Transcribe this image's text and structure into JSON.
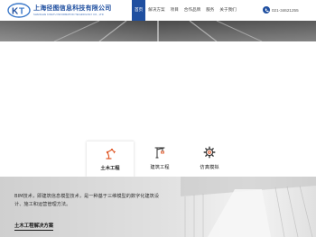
{
  "header": {
    "brand_cn": "上海径图信息科技有限公司",
    "brand_en": "SHANGHAI KINGTU INFORMATION TECHNOLOGY CO., LTD",
    "phone": "021-34621255"
  },
  "nav": {
    "items": [
      {
        "label": "首页",
        "active": true
      },
      {
        "label": "解决方案"
      },
      {
        "label": "项目"
      },
      {
        "label": "合作品牌"
      },
      {
        "label": "服务"
      },
      {
        "label": "关于我们"
      }
    ]
  },
  "services": [
    {
      "label": "土木工程",
      "icon": "robot-arm-icon",
      "active": true
    },
    {
      "label": "建筑工程",
      "icon": "crane-icon"
    },
    {
      "label": "仿真模拟",
      "icon": "gear-icon"
    }
  ],
  "bottom": {
    "description": "BIM技术，即建筑信息模型技术，是一种基于三维模型的数字化建筑设计、施工和运营管理方法。",
    "link": "土木工程解决方案"
  },
  "colors": {
    "brand": "#1f4fa0",
    "nav_active_bg": "#1f4fa0"
  }
}
